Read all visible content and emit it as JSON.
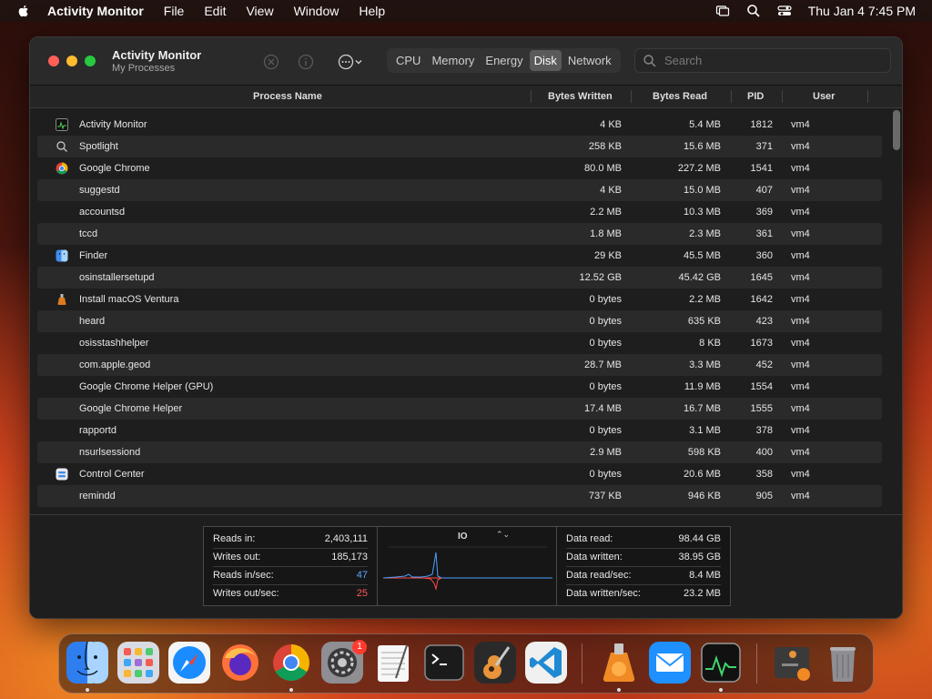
{
  "menubar": {
    "app_name": "Activity Monitor",
    "items": [
      "File",
      "Edit",
      "View",
      "Window",
      "Help"
    ],
    "datetime": "Thu Jan 4  7:45 PM"
  },
  "window": {
    "title": "Activity Monitor",
    "subtitle": "My Processes",
    "tabs": [
      {
        "label": "CPU",
        "active": false
      },
      {
        "label": "Memory",
        "active": false
      },
      {
        "label": "Energy",
        "active": false
      },
      {
        "label": "Disk",
        "active": true
      },
      {
        "label": "Network",
        "active": false
      }
    ],
    "search_placeholder": "Search"
  },
  "table": {
    "columns": {
      "name": "Process Name",
      "bytes_written": "Bytes Written",
      "bytes_read": "Bytes Read",
      "pid": "PID",
      "user": "User"
    },
    "rows": [
      {
        "icon": "activity-monitor-icon",
        "name": "Activity Monitor",
        "bytes_written": "4 KB",
        "bytes_read": "5.4 MB",
        "pid": "1812",
        "user": "vm4"
      },
      {
        "icon": "spotlight-icon",
        "name": "Spotlight",
        "bytes_written": "258 KB",
        "bytes_read": "15.6 MB",
        "pid": "371",
        "user": "vm4"
      },
      {
        "icon": "chrome-icon",
        "name": "Google Chrome",
        "bytes_written": "80.0 MB",
        "bytes_read": "227.2 MB",
        "pid": "1541",
        "user": "vm4"
      },
      {
        "icon": "",
        "name": "suggestd",
        "bytes_written": "4 KB",
        "bytes_read": "15.0 MB",
        "pid": "407",
        "user": "vm4"
      },
      {
        "icon": "",
        "name": "accountsd",
        "bytes_written": "2.2 MB",
        "bytes_read": "10.3 MB",
        "pid": "369",
        "user": "vm4"
      },
      {
        "icon": "",
        "name": "tccd",
        "bytes_written": "1.8 MB",
        "bytes_read": "2.3 MB",
        "pid": "361",
        "user": "vm4"
      },
      {
        "icon": "finder-icon",
        "name": "Finder",
        "bytes_written": "29 KB",
        "bytes_read": "45.5 MB",
        "pid": "360",
        "user": "vm4"
      },
      {
        "icon": "",
        "name": "osinstallersetupd",
        "bytes_written": "12.52 GB",
        "bytes_read": "45.42 GB",
        "pid": "1645",
        "user": "vm4"
      },
      {
        "icon": "installer-icon",
        "name": "Install macOS Ventura",
        "bytes_written": "0 bytes",
        "bytes_read": "2.2 MB",
        "pid": "1642",
        "user": "vm4"
      },
      {
        "icon": "",
        "name": "heard",
        "bytes_written": "0 bytes",
        "bytes_read": "635 KB",
        "pid": "423",
        "user": "vm4"
      },
      {
        "icon": "",
        "name": "osisstashhelper",
        "bytes_written": "0 bytes",
        "bytes_read": "8 KB",
        "pid": "1673",
        "user": "vm4"
      },
      {
        "icon": "",
        "name": "com.apple.geod",
        "bytes_written": "28.7 MB",
        "bytes_read": "3.3 MB",
        "pid": "452",
        "user": "vm4"
      },
      {
        "icon": "",
        "name": "Google Chrome Helper (GPU)",
        "bytes_written": "0 bytes",
        "bytes_read": "11.9 MB",
        "pid": "1554",
        "user": "vm4"
      },
      {
        "icon": "",
        "name": "Google Chrome Helper",
        "bytes_written": "17.4 MB",
        "bytes_read": "16.7 MB",
        "pid": "1555",
        "user": "vm4"
      },
      {
        "icon": "",
        "name": "rapportd",
        "bytes_written": "0 bytes",
        "bytes_read": "3.1 MB",
        "pid": "378",
        "user": "vm4"
      },
      {
        "icon": "",
        "name": "nsurlsessiond",
        "bytes_written": "2.9 MB",
        "bytes_read": "598 KB",
        "pid": "400",
        "user": "vm4"
      },
      {
        "icon": "control-center-icon",
        "name": "Control Center",
        "bytes_written": "0 bytes",
        "bytes_read": "20.6 MB",
        "pid": "358",
        "user": "vm4"
      },
      {
        "icon": "",
        "name": "remindd",
        "bytes_written": "737 KB",
        "bytes_read": "946 KB",
        "pid": "905",
        "user": "vm4"
      }
    ]
  },
  "stats": {
    "left": [
      {
        "key": "Reads in:",
        "value": "2,403,111"
      },
      {
        "key": "Writes out:",
        "value": "185,173"
      },
      {
        "key": "Reads in/sec:",
        "value": "47",
        "color": "blue"
      },
      {
        "key": "Writes out/sec:",
        "value": "25",
        "color": "red"
      }
    ],
    "graph_label": "IO",
    "right": [
      {
        "key": "Data read:",
        "value": "98.44 GB"
      },
      {
        "key": "Data written:",
        "value": "38.95 GB"
      },
      {
        "key": "Data read/sec:",
        "value": "8.4 MB"
      },
      {
        "key": "Data written/sec:",
        "value": "23.2 MB"
      }
    ]
  },
  "dock": {
    "badge_system_settings": "1",
    "items": [
      "finder",
      "launchpad",
      "safari",
      "firefox",
      "chrome",
      "system-settings",
      "textedit",
      "terminal",
      "garageband",
      "vscode",
      "installer",
      "mail",
      "activity-monitor",
      "downloads",
      "trash"
    ]
  },
  "colors": {
    "blue": "#5aa8ff",
    "red": "#ff5a5a",
    "graph_read": "#4aa0ff",
    "graph_write": "#ff4a4a"
  }
}
